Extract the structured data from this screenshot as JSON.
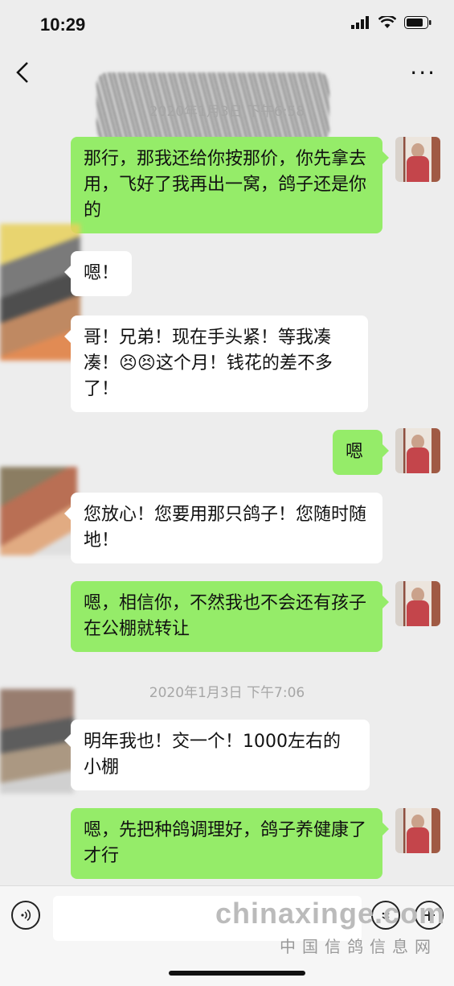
{
  "status_bar": {
    "time": "10:29"
  },
  "nav": {
    "back_icon": "chevron-left-icon",
    "more_label": "···"
  },
  "messages": [
    {
      "type": "timestamp",
      "text": "2020年1月3日 下午6:58"
    },
    {
      "type": "me",
      "text": "那行，那我还给你按那价，你先拿去用，飞好了我再出一窝，鸽子还是你的"
    },
    {
      "type": "other",
      "text": "嗯！"
    },
    {
      "type": "other",
      "text": "哥！兄弟！现在手头紧！等我凑凑！😣😣这个月！钱花的差不多了！"
    },
    {
      "type": "me",
      "text": "嗯"
    },
    {
      "type": "other",
      "text": "您放心！您要用那只鸽子！您随时随地！"
    },
    {
      "type": "me",
      "text": "嗯，相信你，不然我也不会还有孩子在公棚就转让"
    },
    {
      "type": "timestamp",
      "text": "2020年1月3日 下午7:06"
    },
    {
      "type": "other",
      "text": "明年我也！交一个！1000左右的小棚"
    },
    {
      "type": "me",
      "text": "嗯，先把种鸽调理好，鸽子养健康了才行"
    }
  ],
  "input_bar": {
    "placeholder": ""
  },
  "watermark": {
    "main": "chinaxinge.com",
    "sub": "中国信鸽信息网"
  }
}
